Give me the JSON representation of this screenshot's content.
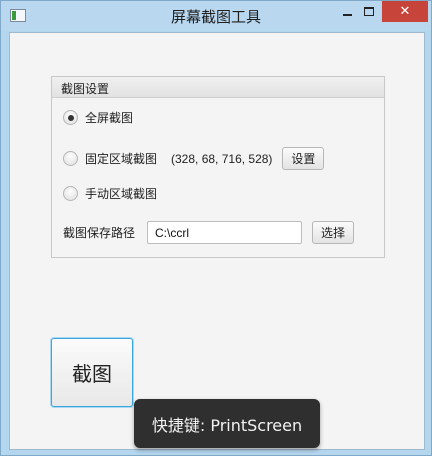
{
  "window": {
    "title": "屏幕截图工具",
    "close_symbol": "✕"
  },
  "settings": {
    "group_title": "截图设置",
    "options": [
      {
        "label": "全屏截图",
        "checked": true
      },
      {
        "label": "固定区域截图",
        "checked": false,
        "region": "(328, 68, 716, 528)",
        "button": "设置"
      },
      {
        "label": "手动区域截图",
        "checked": false
      }
    ],
    "save_path_label": "截图保存路径",
    "save_path_value": "C:\\ccrl",
    "choose_button": "选择"
  },
  "capture_button": "截图",
  "tooltip": "快捷键: PrintScreen",
  "icons": {
    "app": "app-window-icon",
    "minimize": "minimize-icon",
    "maximize": "maximize-icon",
    "close": "close-icon"
  },
  "colors": {
    "titlebar": "#b9d8f0",
    "close": "#c7443a",
    "focus": "#3aa7e0",
    "tooltip_bg": "#2f2f2f"
  }
}
